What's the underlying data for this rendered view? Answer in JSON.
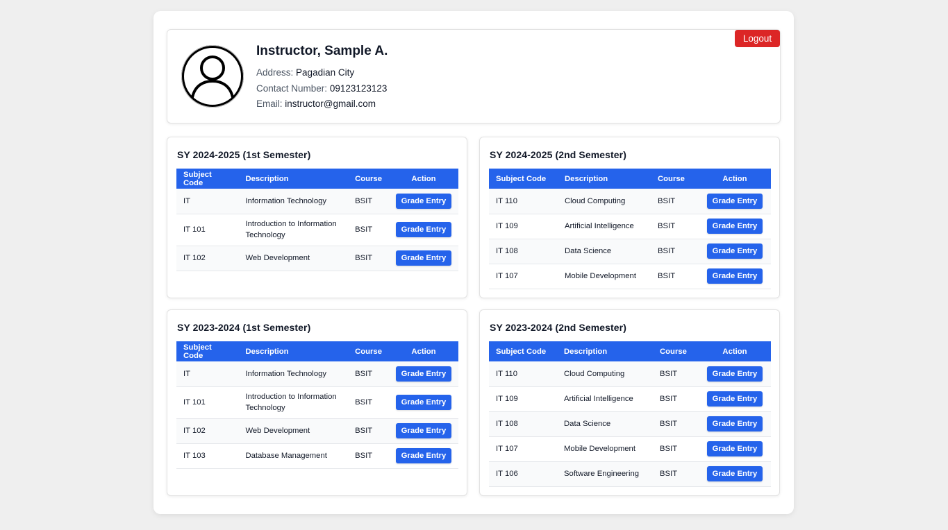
{
  "profile": {
    "name": "Instructor, Sample A.",
    "address_label": "Address:",
    "address": "Pagadian City",
    "contact_label": "Contact Number:",
    "contact": "09123123123",
    "email_label": "Email:",
    "email": "instructor@gmail.com",
    "logout_label": "Logout"
  },
  "table_headers": {
    "code": "Subject Code",
    "description": "Description",
    "course": "Course",
    "action": "Action"
  },
  "grade_entry_label": "Grade Entry",
  "semesters": [
    {
      "title": "SY 2024-2025 (1st Semester)",
      "rows": [
        {
          "code": "IT",
          "description": "Information Technology",
          "course": "BSIT"
        },
        {
          "code": "IT 101",
          "description": "Introduction to Information Technology",
          "course": "BSIT"
        },
        {
          "code": "IT 102",
          "description": "Web Development",
          "course": "BSIT"
        }
      ]
    },
    {
      "title": "SY 2024-2025 (2nd Semester)",
      "rows": [
        {
          "code": "IT 110",
          "description": "Cloud Computing",
          "course": "BSIT"
        },
        {
          "code": "IT 109",
          "description": "Artificial Intelligence",
          "course": "BSIT"
        },
        {
          "code": "IT 108",
          "description": "Data Science",
          "course": "BSIT"
        },
        {
          "code": "IT 107",
          "description": "Mobile Development",
          "course": "BSIT"
        }
      ]
    },
    {
      "title": "SY 2023-2024 (1st Semester)",
      "rows": [
        {
          "code": "IT",
          "description": "Information Technology",
          "course": "BSIT"
        },
        {
          "code": "IT 101",
          "description": "Introduction to Information Technology",
          "course": "BSIT"
        },
        {
          "code": "IT 102",
          "description": "Web Development",
          "course": "BSIT"
        },
        {
          "code": "IT 103",
          "description": "Database Management",
          "course": "BSIT"
        }
      ]
    },
    {
      "title": "SY 2023-2024 (2nd Semester)",
      "rows": [
        {
          "code": "IT 110",
          "description": "Cloud Computing",
          "course": "BSIT"
        },
        {
          "code": "IT 109",
          "description": "Artificial Intelligence",
          "course": "BSIT"
        },
        {
          "code": "IT 108",
          "description": "Data Science",
          "course": "BSIT"
        },
        {
          "code": "IT 107",
          "description": "Mobile Development",
          "course": "BSIT"
        },
        {
          "code": "IT 106",
          "description": "Software Engineering",
          "course": "BSIT"
        }
      ]
    }
  ],
  "colors": {
    "primary": "#2563eb",
    "danger": "#dc2626",
    "page_bg": "#efefef"
  },
  "icons": {
    "avatar": "user-avatar-icon"
  }
}
